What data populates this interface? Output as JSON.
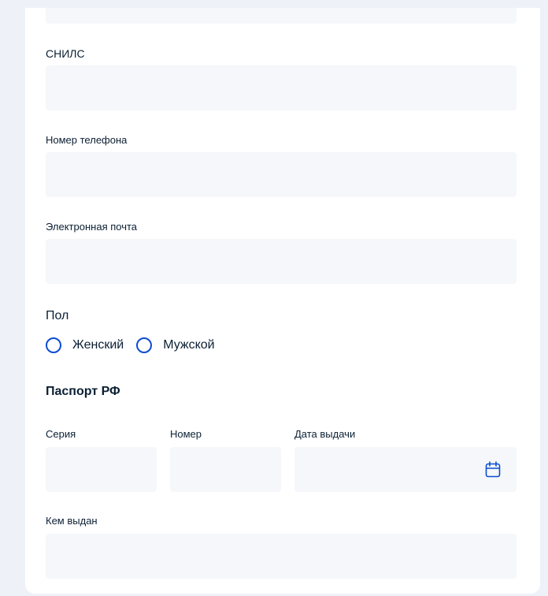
{
  "form": {
    "snils_label": "СНИЛС",
    "phone_label": "Номер телефона",
    "email_label": "Электронная почта",
    "gender_label": "Пол",
    "gender_options": [
      "Женский",
      "Мужской"
    ],
    "passport_heading": "Паспорт РФ",
    "series_label": "Серия",
    "number_label": "Номер",
    "issue_date_label": "Дата выдачи",
    "issued_by_label": "Кем выдан"
  },
  "icons": {
    "calendar": "calendar-icon"
  },
  "colors": {
    "accent": "#0d4cd3",
    "field_bg": "#f5f7fa",
    "page_bg": "#eef2f8",
    "text": "#0b1f33"
  }
}
